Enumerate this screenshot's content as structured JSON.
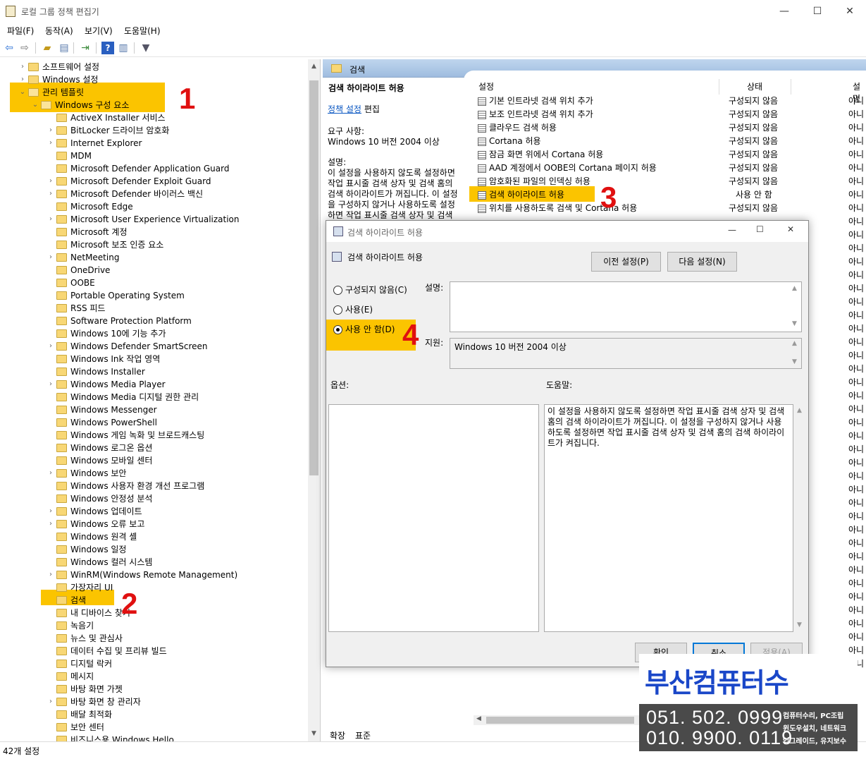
{
  "window": {
    "title": "로컬 그룹 정책 편집기",
    "min": "—",
    "max": "☐",
    "close": "✕"
  },
  "menu": [
    "파일(F)",
    "동작(A)",
    "보기(V)",
    "도움말(H)"
  ],
  "tree": {
    "items": [
      {
        "label": "소프트웨어 설정",
        "level": 1,
        "exp": "›"
      },
      {
        "label": "Windows 설정",
        "level": 1,
        "exp": "›"
      },
      {
        "label": "관리 템플릿",
        "level": 1,
        "exp": "⌄",
        "open": true
      },
      {
        "label": "Windows 구성 요소",
        "level": 2,
        "exp": "⌄",
        "open": true
      },
      {
        "label": "ActiveX Installer 서비스",
        "level": 3,
        "exp": ""
      },
      {
        "label": "BitLocker 드라이브 암호화",
        "level": 3,
        "exp": "›"
      },
      {
        "label": "Internet Explorer",
        "level": 3,
        "exp": "›"
      },
      {
        "label": "MDM",
        "level": 3,
        "exp": ""
      },
      {
        "label": "Microsoft Defender Application Guard",
        "level": 3,
        "exp": ""
      },
      {
        "label": "Microsoft Defender Exploit Guard",
        "level": 3,
        "exp": "›"
      },
      {
        "label": "Microsoft Defender 바이러스 백신",
        "level": 3,
        "exp": "›"
      },
      {
        "label": "Microsoft Edge",
        "level": 3,
        "exp": ""
      },
      {
        "label": "Microsoft User Experience Virtualization",
        "level": 3,
        "exp": "›"
      },
      {
        "label": "Microsoft 계정",
        "level": 3,
        "exp": ""
      },
      {
        "label": "Microsoft 보조 인증 요소",
        "level": 3,
        "exp": ""
      },
      {
        "label": "NetMeeting",
        "level": 3,
        "exp": "›"
      },
      {
        "label": "OneDrive",
        "level": 3,
        "exp": ""
      },
      {
        "label": "OOBE",
        "level": 3,
        "exp": ""
      },
      {
        "label": "Portable Operating System",
        "level": 3,
        "exp": ""
      },
      {
        "label": "RSS 피드",
        "level": 3,
        "exp": ""
      },
      {
        "label": "Software Protection Platform",
        "level": 3,
        "exp": ""
      },
      {
        "label": "Windows 10에 기능 추가",
        "level": 3,
        "exp": ""
      },
      {
        "label": "Windows Defender SmartScreen",
        "level": 3,
        "exp": "›"
      },
      {
        "label": "Windows Ink 작업 영역",
        "level": 3,
        "exp": ""
      },
      {
        "label": "Windows Installer",
        "level": 3,
        "exp": ""
      },
      {
        "label": "Windows Media Player",
        "level": 3,
        "exp": "›"
      },
      {
        "label": "Windows Media 디지털 권한 관리",
        "level": 3,
        "exp": ""
      },
      {
        "label": "Windows Messenger",
        "level": 3,
        "exp": ""
      },
      {
        "label": "Windows PowerShell",
        "level": 3,
        "exp": ""
      },
      {
        "label": "Windows 게임 녹화 및 브로드캐스팅",
        "level": 3,
        "exp": ""
      },
      {
        "label": "Windows 로그온 옵션",
        "level": 3,
        "exp": ""
      },
      {
        "label": "Windows 모바일 센터",
        "level": 3,
        "exp": ""
      },
      {
        "label": "Windows 보안",
        "level": 3,
        "exp": "›"
      },
      {
        "label": "Windows 사용자 환경 개선 프로그램",
        "level": 3,
        "exp": ""
      },
      {
        "label": "Windows 안정성 분석",
        "level": 3,
        "exp": ""
      },
      {
        "label": "Windows 업데이트",
        "level": 3,
        "exp": "›"
      },
      {
        "label": "Windows 오류 보고",
        "level": 3,
        "exp": "›"
      },
      {
        "label": "Windows 원격 셸",
        "level": 3,
        "exp": ""
      },
      {
        "label": "Windows 일정",
        "level": 3,
        "exp": ""
      },
      {
        "label": "Windows 컬러 시스템",
        "level": 3,
        "exp": ""
      },
      {
        "label": "WinRM(Windows Remote Management)",
        "level": 3,
        "exp": "›"
      },
      {
        "label": "가장자리 UI",
        "level": 3,
        "exp": ""
      },
      {
        "label": "검색",
        "level": 3,
        "exp": "",
        "selected": true
      },
      {
        "label": "내 디바이스 찾기",
        "level": 3,
        "exp": ""
      },
      {
        "label": "녹음기",
        "level": 3,
        "exp": ""
      },
      {
        "label": "뉴스 및 관심사",
        "level": 3,
        "exp": ""
      },
      {
        "label": "데이터 수집 및 프리뷰 빌드",
        "level": 3,
        "exp": ""
      },
      {
        "label": "디지털 락커",
        "level": 3,
        "exp": ""
      },
      {
        "label": "메시지",
        "level": 3,
        "exp": ""
      },
      {
        "label": "바탕 화면 가젯",
        "level": 3,
        "exp": ""
      },
      {
        "label": "바탕 화면 창 관리자",
        "level": 3,
        "exp": "›"
      },
      {
        "label": "배달 최적화",
        "level": 3,
        "exp": ""
      },
      {
        "label": "보안 센터",
        "level": 3,
        "exp": ""
      },
      {
        "label": "비즈니스용 Windows Hello",
        "level": 3,
        "exp": ""
      }
    ]
  },
  "right": {
    "header": "검색",
    "ext_title": "검색 하이라이트 허용",
    "edit_link": "정책 설정",
    "edit_suffix": "편집",
    "req_label": "요구 사항:",
    "req_value": "Windows 10 버전 2004 이상",
    "desc_label": "설명:",
    "desc_lines": [
      "이 설정을 사용하지 않도록 설정하면",
      "작업 표시줄 검색 상자 및 검색 홈의",
      "검색 하이라이트가 꺼집니다. 이 설정",
      "을 구성하지 않거나 사용하도록 설정",
      "하면 작업 표시줄 검색 상자 및 검색"
    ],
    "col_setting": "설정",
    "col_state": "상태",
    "col_comment": "설명",
    "settings": [
      {
        "name": "기본 인트라넷 검색 위치 추가",
        "state": "구성되지 않음",
        "comment": "아니"
      },
      {
        "name": "보조 인트라넷 검색 위치 추가",
        "state": "구성되지 않음",
        "comment": "아니"
      },
      {
        "name": "클라우드 검색 허용",
        "state": "구성되지 않음",
        "comment": "아니"
      },
      {
        "name": "Cortana 허용",
        "state": "구성되지 않음",
        "comment": "아니"
      },
      {
        "name": "잠금 화면 위에서 Cortana 허용",
        "state": "구성되지 않음",
        "comment": "아니"
      },
      {
        "name": "AAD 계정에서 OOBE의 Cortana 페이지 허용",
        "state": "구성되지 않음",
        "comment": "아니"
      },
      {
        "name": "암호화된 파일의 인덱싱 허용",
        "state": "구성되지 않음",
        "comment": "아니"
      },
      {
        "name": "검색 하이라이트 허용",
        "state": "사용 안 함",
        "comment": "아니",
        "selected": true
      },
      {
        "name": "위치를 사용하도록 검색 및 Cortana 허용",
        "state": "구성되지 않음",
        "comment": "아니"
      }
    ],
    "more_comments": "아니"
  },
  "tabs": [
    "확장",
    "표준"
  ],
  "status": "42개 설정",
  "dialog": {
    "title": "검색 하이라이트 허용",
    "policy_name": "검색 하이라이트 허용",
    "prev_btn": "이전 설정(P)",
    "next_btn": "다음 설정(N)",
    "opt_not_configured": "구성되지 않음(C)",
    "opt_enabled": "사용(E)",
    "opt_disabled": "사용 안 함(D)",
    "comment_label": "설명:",
    "support_label": "지원:",
    "support_value": "Windows 10 버전 2004 이상",
    "options_label": "옵션:",
    "help_label": "도움말:",
    "help_text": "이 설정을 사용하지 않도록 설정하면 작업 표시줄 검색 상자 및 검색 홈의 검색 하이라이트가 꺼집니다. 이 설정을 구성하지 않거나 사용하도록 설정하면 작업 표시줄 검색 상자 및 검색 홈의 검색 하이라이트가 켜집니다.",
    "ok": "확인",
    "cancel": "취소",
    "apply": "적용(A)",
    "selected_option": "disabled"
  },
  "annotations": {
    "n1": "1",
    "n2": "2",
    "n3": "3",
    "n4": "4",
    "highlight_color": "#fbc400",
    "number_color": "#e01010"
  },
  "ad": {
    "brand": "부산컴퓨터수리.com",
    "phone1": "051. 502. 0999",
    "phone2": "010. 9900. 0119",
    "svc1": "컴퓨터수리, PC조립",
    "svc2": "윈도우설치, 네트워크",
    "svc3": "업그레이드, 유지보수"
  }
}
